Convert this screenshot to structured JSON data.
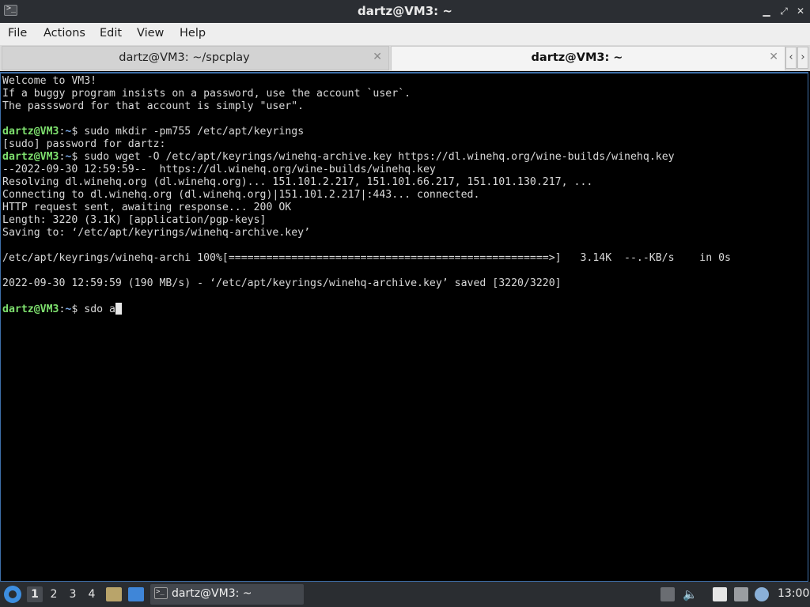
{
  "window": {
    "title": "dartz@VM3: ~",
    "icon": "terminal-icon",
    "controls": [
      "minimize-icon",
      "maximize-icon",
      "close-icon"
    ]
  },
  "menubar": {
    "items": [
      "File",
      "Actions",
      "Edit",
      "View",
      "Help"
    ]
  },
  "tabs": [
    {
      "label": "dartz@VM3: ~/spcplay",
      "active": false
    },
    {
      "label": "dartz@VM3: ~",
      "active": true
    }
  ],
  "tab_scroll": {
    "left": "‹",
    "right": "›"
  },
  "terminal": {
    "lines": [
      {
        "kind": "text",
        "text": "Welcome to VM3!"
      },
      {
        "kind": "text",
        "text": "If a buggy program insists on a password, use the account `user`."
      },
      {
        "kind": "text",
        "text": "The passsword for that account is simply \"user\"."
      },
      {
        "kind": "text",
        "text": ""
      },
      {
        "kind": "prompt",
        "user": "dartz@VM3",
        "path": "~",
        "cmd": "sudo mkdir -pm755 /etc/apt/keyrings"
      },
      {
        "kind": "text",
        "text": "[sudo] password for dartz:"
      },
      {
        "kind": "prompt",
        "user": "dartz@VM3",
        "path": "~",
        "cmd": "sudo wget -O /etc/apt/keyrings/winehq-archive.key https://dl.winehq.org/wine-builds/winehq.key"
      },
      {
        "kind": "text",
        "text": "--2022-09-30 12:59:59--  https://dl.winehq.org/wine-builds/winehq.key"
      },
      {
        "kind": "text",
        "text": "Resolving dl.winehq.org (dl.winehq.org)... 151.101.2.217, 151.101.66.217, 151.101.130.217, ..."
      },
      {
        "kind": "text",
        "text": "Connecting to dl.winehq.org (dl.winehq.org)|151.101.2.217|:443... connected."
      },
      {
        "kind": "text",
        "text": "HTTP request sent, awaiting response... 200 OK"
      },
      {
        "kind": "text",
        "text": "Length: 3220 (3.1K) [application/pgp-keys]"
      },
      {
        "kind": "text",
        "text": "Saving to: ‘/etc/apt/keyrings/winehq-archive.key’"
      },
      {
        "kind": "text",
        "text": ""
      },
      {
        "kind": "text",
        "text": "/etc/apt/keyrings/winehq-archi 100%[===================================================>]   3.14K  --.-KB/s    in 0s"
      },
      {
        "kind": "text",
        "text": ""
      },
      {
        "kind": "text",
        "text": "2022-09-30 12:59:59 (190 MB/s) - ‘/etc/apt/keyrings/winehq-archive.key’ saved [3220/3220]"
      },
      {
        "kind": "text",
        "text": ""
      },
      {
        "kind": "prompt",
        "user": "dartz@VM3",
        "path": "~",
        "cmd": "sdo a",
        "cursor": true
      }
    ]
  },
  "taskbar": {
    "start_icon": "start-menu-icon",
    "workspaces": [
      "1",
      "2",
      "3",
      "4"
    ],
    "active_workspace": "1",
    "launchers": [
      "file-manager-icon",
      "show-desktop-icon"
    ],
    "task": {
      "label": "dartz@VM3: ~",
      "icon": "terminal-icon"
    },
    "tray": [
      "upload-icon",
      "volume-icon",
      "clipboard-icon",
      "network-icon",
      "notification-icon"
    ],
    "clock": "13:00"
  },
  "colors": {
    "prompt_user": "#7ee06e",
    "prompt_path": "#79a8e6",
    "terminal_bg": "#000000",
    "terminal_fg": "#d8d8d8",
    "active_border": "#3d6ea8"
  }
}
